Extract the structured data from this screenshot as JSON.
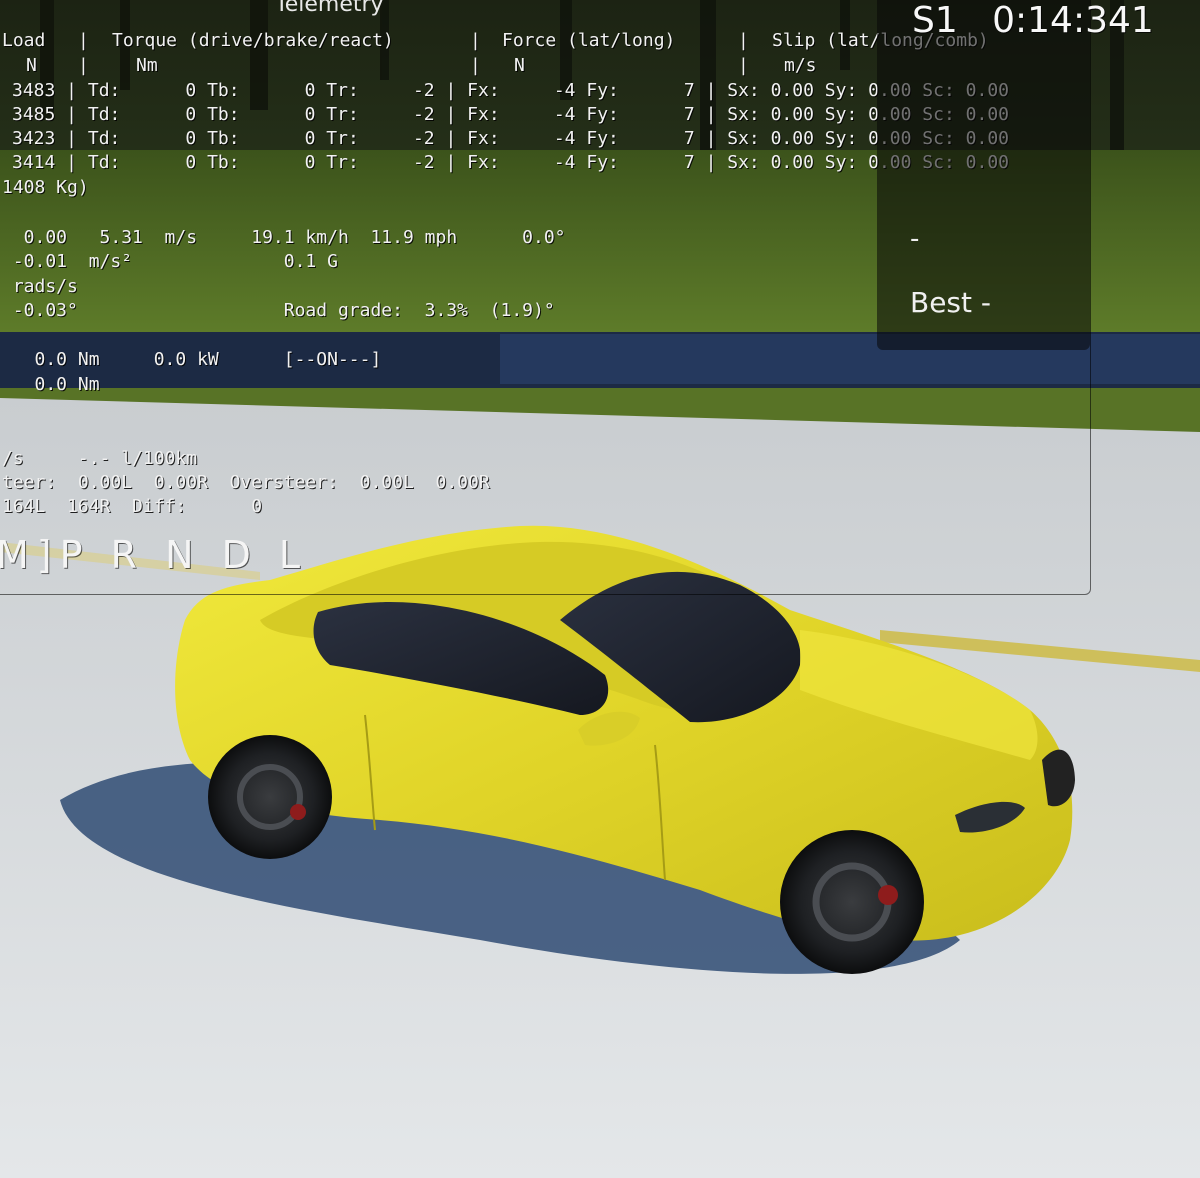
{
  "hud": {
    "title": "Telemetry",
    "headers": {
      "load": "Load",
      "load_unit": "N",
      "torque": "Torque (drive/brake/react)",
      "torque_unit": "Nm",
      "force": "Force (lat/long)",
      "force_unit": "N",
      "slip": "Slip (lat/long/comb)",
      "slip_unit": "m/s"
    },
    "wheel_rows": [
      "3483 | Td:      0 Tb:      0 Tr:     -2 | Fx:     -4 Fy:      7 | Sx: 0.00 Sy: 0.00 Sc: 0.00",
      "3485 | Td:      0 Tb:      0 Tr:     -2 | Fx:     -4 Fy:      7 | Sx: 0.00 Sy: 0.00 Sc: 0.00",
      "3423 | Td:      0 Tb:      0 Tr:     -2 | Fx:     -4 Fy:      7 | Sx: 0.00 Sy: 0.00 Sc: 0.00",
      "3414 | Td:      0 Tb:      0 Tr:     -2 | Fx:     -4 Fy:      7 | Sx: 0.00 Sy: 0.00 Sc: 0.00"
    ],
    "mass": "1408 Kg)",
    "velocity_line": "  0.00   5.31  m/s     19.1 km/h  11.9 mph      0.0°",
    "accel_line": " -0.01  m/s²              0.1 G",
    "rads_line": " rads/s",
    "angle_line": " -0.03°                   Road grade:  3.3%  (1.9)°",
    "engine_line1": "   0.0 Nm     0.0 kW      [--ON---]",
    "engine_line2": "   0.0 Nm",
    "fuel_line": "/s     -.- l/100km",
    "steer_line": "teer:  0.00L  0.00R  Oversteer:  0.00L  0.00R",
    "diff_line": "164L  164R  Diff:      0",
    "gear_selector": "M]P R N D L"
  },
  "timer": {
    "sector": "S1",
    "time": "0:14:341",
    "current": "-",
    "best": "Best -"
  },
  "colors": {
    "car_body": "#e6dd2c",
    "grass": "#4e6a23",
    "road": "#dde1e3",
    "hud_text": "#f2f2f2"
  }
}
